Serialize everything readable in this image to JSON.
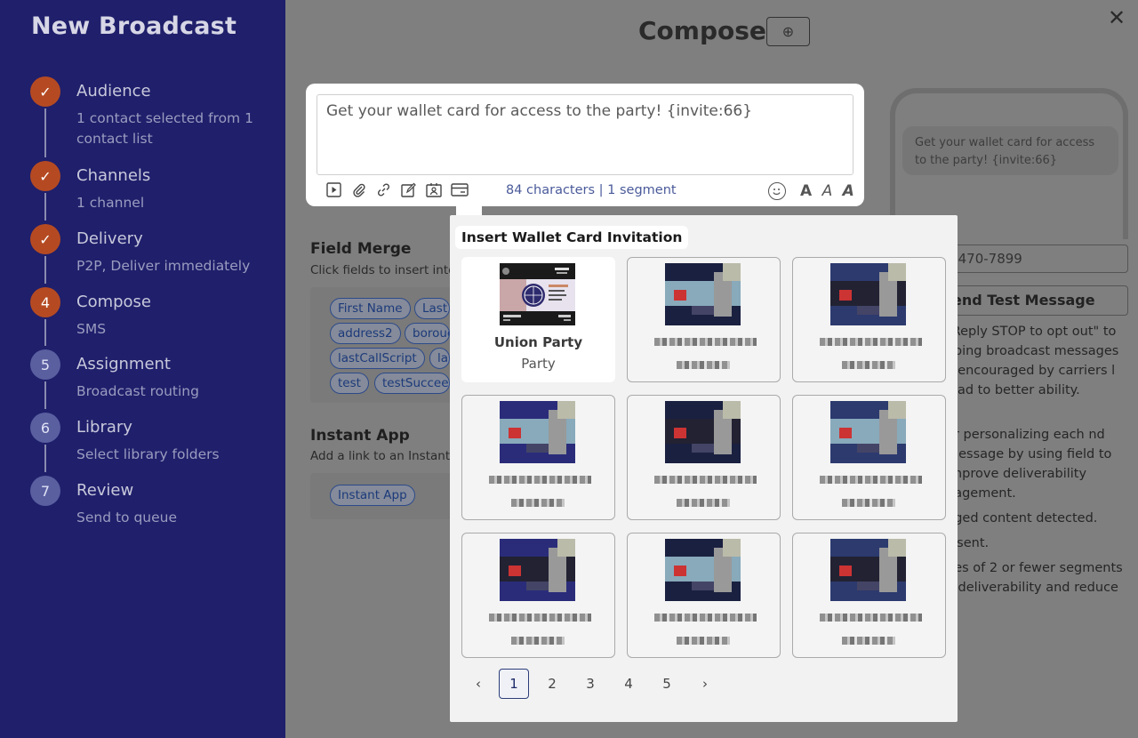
{
  "sidebar": {
    "title": "New Broadcast",
    "steps": [
      {
        "marker": "✓",
        "title": "Audience",
        "sub": "1 contact selected from 1 contact list",
        "state": "done"
      },
      {
        "marker": "✓",
        "title": "Channels",
        "sub": "1 channel",
        "state": "done"
      },
      {
        "marker": "✓",
        "title": "Delivery",
        "sub": "P2P, Deliver immediately",
        "state": "done"
      },
      {
        "marker": "4",
        "title": "Compose",
        "sub": "SMS",
        "state": "active"
      },
      {
        "marker": "5",
        "title": "Assignment",
        "sub": "Broadcast routing",
        "state": "todo"
      },
      {
        "marker": "6",
        "title": "Library",
        "sub": "Select library folders",
        "state": "todo"
      },
      {
        "marker": "7",
        "title": "Review",
        "sub": "Send to queue",
        "state": "todo"
      }
    ]
  },
  "header": {
    "title": "Compose",
    "add_icon": "plus-circle-icon",
    "close_icon": "close-icon"
  },
  "editor": {
    "text": "Get your wallet card for access to the party! {invite:66}",
    "char_count": "84 characters | 1 segment",
    "tools": [
      "video-icon",
      "attachment-icon",
      "link-icon",
      "edit-icon",
      "contact-card-icon",
      "wallet-card-icon"
    ],
    "font_labels": [
      "A",
      "A",
      "A"
    ]
  },
  "field_merge": {
    "title": "Field Merge",
    "subtitle": "Click fields to insert into t",
    "chips": [
      "First Name",
      "Last",
      "address2",
      "boroug",
      "lastCallScript",
      "las",
      "test",
      "testSucceed"
    ]
  },
  "instant_app": {
    "title": "Instant App",
    "subtitle": "Add a link to an Instant A",
    "chip": "Instant App"
  },
  "preview": {
    "bubble": "Get your wallet card for access to the party! {invite:66}",
    "phone_value": ") 470-7899",
    "test_button": "end Test Message",
    "tips": [
      "\"Reply STOP to opt out\" to going broadcast messages y encouraged by carriers l lead to better ability.",
      "er personalizing each nd message by using field to improve deliverability gagement.",
      "gged content detected.",
      "s sent.",
      "ges of 2 or fewer segments e deliverability and reduce"
    ]
  },
  "wallet_popover": {
    "title": "Insert Wallet Card Invitation",
    "selected_card": {
      "name": "Union Party",
      "sub": "Party"
    },
    "pages": [
      "1",
      "2",
      "3",
      "4",
      "5"
    ],
    "current_page": "1",
    "prev_label": "‹",
    "next_label": "›"
  }
}
